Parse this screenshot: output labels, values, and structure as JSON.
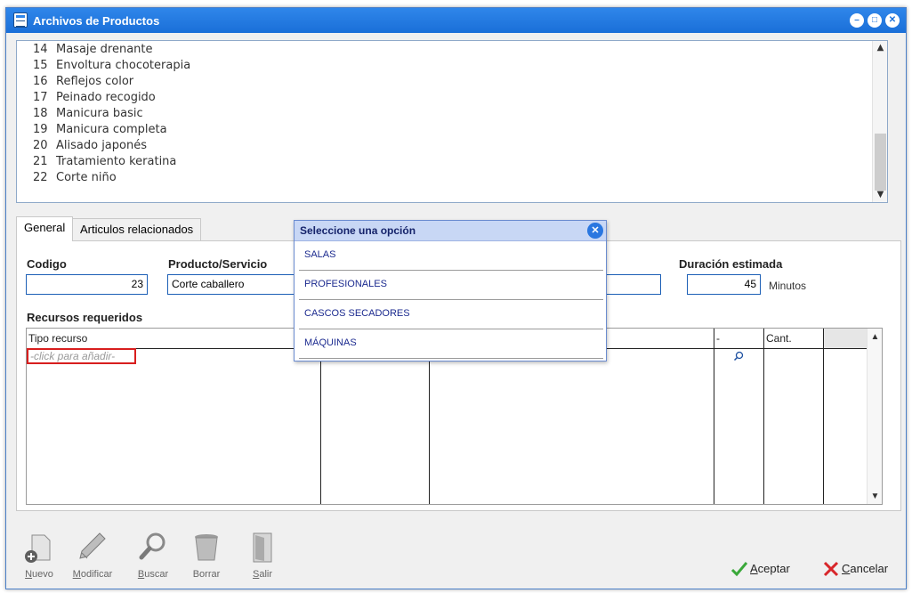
{
  "window": {
    "title": "Archivos de Productos",
    "controls": [
      "minimize",
      "restore",
      "close"
    ]
  },
  "product_list": {
    "items": [
      {
        "num": "14",
        "name": "Masaje drenante"
      },
      {
        "num": "15",
        "name": "Envoltura chocoterapia"
      },
      {
        "num": "16",
        "name": "Reflejos color"
      },
      {
        "num": "17",
        "name": "Peinado recogido"
      },
      {
        "num": "18",
        "name": "Manicura basic"
      },
      {
        "num": "19",
        "name": "Manicura completa"
      },
      {
        "num": "20",
        "name": "Alisado japonés"
      },
      {
        "num": "21",
        "name": "Tratamiento keratina"
      },
      {
        "num": "22",
        "name": "Corte niño"
      }
    ]
  },
  "tabs": [
    {
      "label": "General",
      "active": true
    },
    {
      "label": "Articulos relacionados",
      "active": false
    }
  ],
  "form": {
    "codigo_label": "Codigo",
    "codigo_value": "23",
    "producto_label": "Producto/Servicio",
    "producto_value": "Corte caballero",
    "duracion_label": "Duración estimada",
    "duracion_value": "45",
    "duracion_unit": "Minutos",
    "recursos_label": "Recursos requeridos"
  },
  "grid": {
    "headers": {
      "tipo": "Tipo recurso",
      "dash": "-",
      "cant": "Cant."
    },
    "placeholder": "-click para añadir-"
  },
  "popup": {
    "title": "Seleccione una opción",
    "options": [
      "SALAS",
      "PROFESIONALES",
      "CASCOS SECADORES",
      "MÁQUINAS"
    ]
  },
  "toolbar": {
    "nuevo": {
      "first": "N",
      "rest": "uevo"
    },
    "modificar": {
      "first": "M",
      "rest": "odificar"
    },
    "buscar": {
      "first": "B",
      "rest": "uscar"
    },
    "borrar": {
      "first": "",
      "rest": "Borrar"
    },
    "salir": {
      "first": "S",
      "rest": "alir"
    }
  },
  "actions": {
    "aceptar": {
      "first": "A",
      "rest": "ceptar"
    },
    "cancelar": {
      "first": "C",
      "rest": "ancelar"
    }
  },
  "colors": {
    "titlebar": "#1a6fd8",
    "popup_header": "#c8d7f5",
    "placeholder_border": "#d81e1e",
    "accept_check": "#3aa83a",
    "cancel_x": "#d8262a"
  }
}
